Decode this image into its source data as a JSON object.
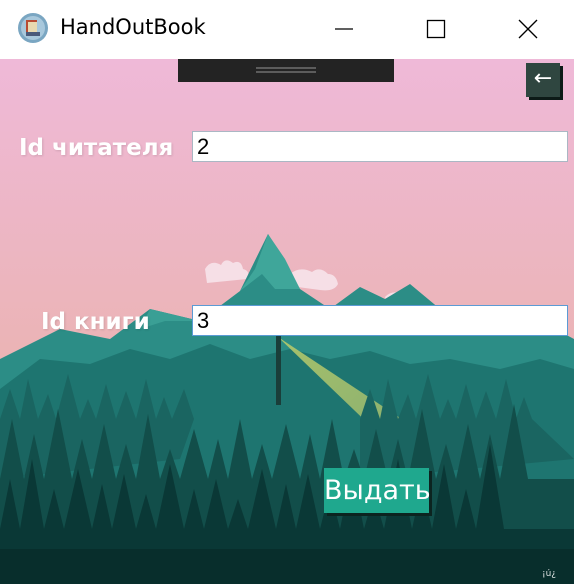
{
  "window": {
    "title": "HandOutBook",
    "icon": "book-stack-icon",
    "controls": {
      "minimize": "minimize-icon",
      "maximize": "maximize-icon",
      "close": "close-icon"
    }
  },
  "toolbar": {
    "back_label": "←",
    "back_icon": "back-arrow-icon"
  },
  "form": {
    "reader_label": "Id читателя",
    "reader_value": "2",
    "book_label": "Id книги",
    "book_value": "3",
    "submit_label": "Выдать"
  },
  "background": {
    "watermark": "¡ú¿",
    "sky_top": "#efb8d6",
    "sky_bottom": "#e9b0a4",
    "forest": "#0f4b45"
  },
  "colors": {
    "accent": "#1fa88e",
    "back_button": "#2f4640"
  }
}
